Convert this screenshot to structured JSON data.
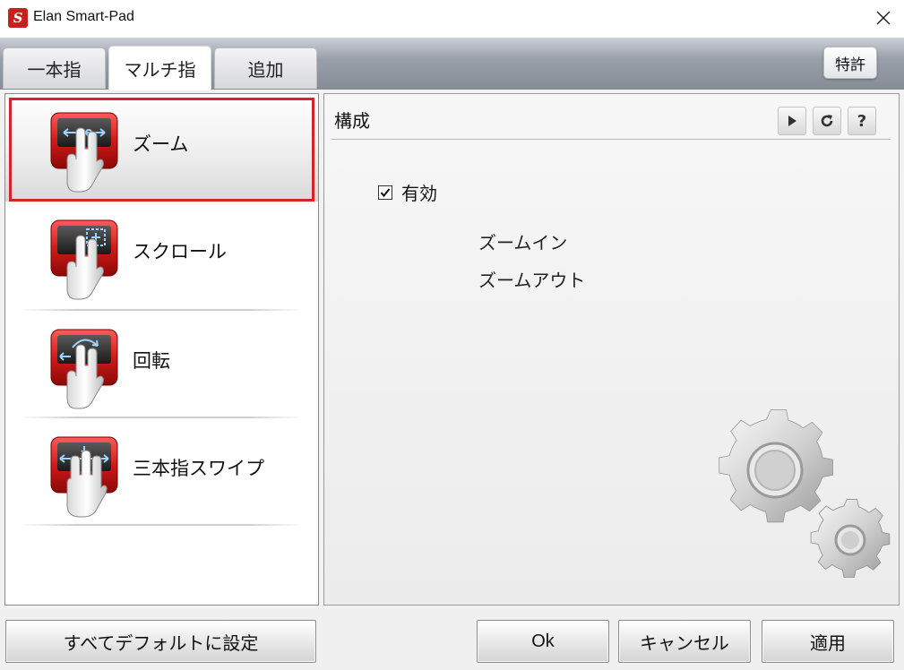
{
  "window": {
    "title": "Elan Smart-Pad",
    "app_icon_letter": "S",
    "close_icon": "close-icon"
  },
  "tabs": [
    {
      "label": "一本指",
      "active": false
    },
    {
      "label": "マルチ指",
      "active": true
    },
    {
      "label": "追加",
      "active": false
    }
  ],
  "patent_button": "特許",
  "gestures": [
    {
      "label": "ズーム",
      "icon": "zoom-gesture-icon",
      "selected": true
    },
    {
      "label": "スクロール",
      "icon": "scroll-gesture-icon",
      "selected": false
    },
    {
      "label": "回転",
      "icon": "rotate-gesture-icon",
      "selected": false
    },
    {
      "label": "三本指スワイプ",
      "icon": "three-finger-swipe-icon",
      "selected": false
    }
  ],
  "config": {
    "title": "構成",
    "toolbar": {
      "play_icon": "play-icon",
      "refresh_icon": "refresh-icon",
      "help_label": "?"
    },
    "enable_label": "有効",
    "enable_checked": true,
    "options": [
      "ズームイン",
      "ズームアウト"
    ]
  },
  "buttons": {
    "default": "すべてデフォルトに設定",
    "ok": "Ok",
    "cancel": "キャンセル",
    "apply": "適用"
  },
  "colors": {
    "selection_outline": "#d6232a",
    "icon_red": "#c8201e"
  }
}
